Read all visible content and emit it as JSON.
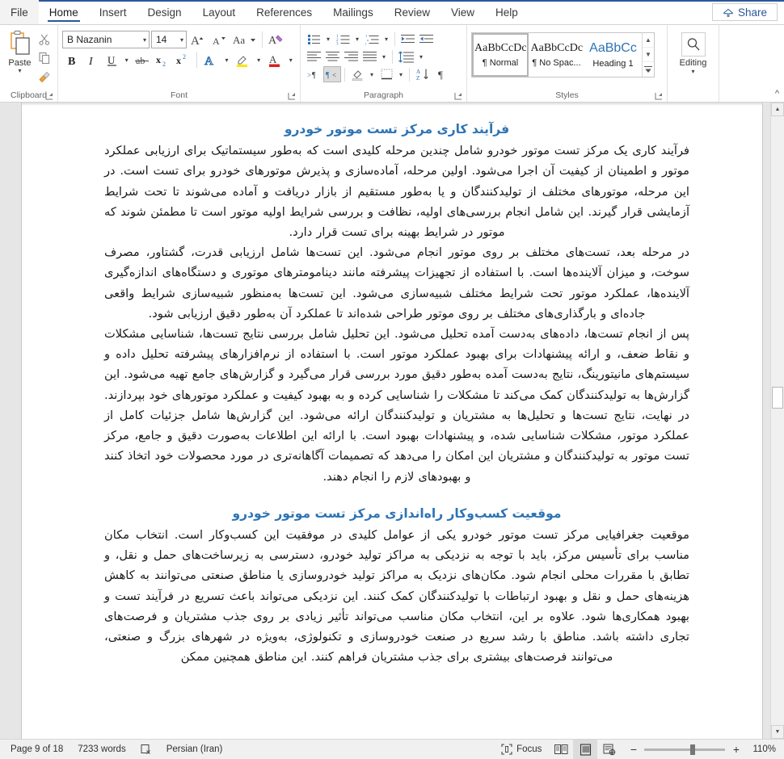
{
  "app": {
    "name": "Microsoft Word",
    "accent_color": "#2b579a",
    "heading_color": "#2e74b5"
  },
  "tabs": [
    {
      "label": "File",
      "name": "tab-file",
      "active": false
    },
    {
      "label": "Home",
      "name": "tab-home",
      "active": true
    },
    {
      "label": "Insert",
      "name": "tab-insert",
      "active": false
    },
    {
      "label": "Design",
      "name": "tab-design",
      "active": false
    },
    {
      "label": "Layout",
      "name": "tab-layout",
      "active": false
    },
    {
      "label": "References",
      "name": "tab-references",
      "active": false
    },
    {
      "label": "Mailings",
      "name": "tab-mailings",
      "active": false
    },
    {
      "label": "Review",
      "name": "tab-review",
      "active": false
    },
    {
      "label": "View",
      "name": "tab-view",
      "active": false
    },
    {
      "label": "Help",
      "name": "tab-help",
      "active": false
    }
  ],
  "share": {
    "label": "Share",
    "icon": "share-icon"
  },
  "ribbon": {
    "clipboard": {
      "group_label": "Clipboard",
      "paste_label": "Paste",
      "icons": [
        "paste-icon",
        "cut-scissors-icon",
        "copy-icon",
        "format-painter-icon"
      ]
    },
    "font": {
      "group_label": "Font",
      "font_name": "B Nazanin",
      "font_size": "14",
      "icons": [
        "grow-font-icon",
        "shrink-font-icon",
        "change-case-icon",
        "clear-formatting-icon",
        "bold-icon",
        "italic-icon",
        "underline-icon",
        "strikethrough-icon",
        "subscript-icon",
        "superscript-icon",
        "text-effects-icon",
        "text-highlight-color-icon",
        "font-color-icon"
      ]
    },
    "paragraph": {
      "group_label": "Paragraph",
      "icons": [
        "bullets-icon",
        "numbering-icon",
        "multilevel-list-icon",
        "increase-indent-icon",
        "decrease-indent-icon",
        "align-left-icon",
        "align-center-icon",
        "align-right-icon",
        "justify-icon",
        "line-spacing-icon",
        "ltr-text-direction-icon",
        "rtl-text-direction-icon",
        "shading-icon",
        "borders-icon",
        "sort-icon",
        "show-formatting-marks-icon"
      ],
      "active_icon": "rtl-text-direction-icon"
    },
    "styles": {
      "group_label": "Styles",
      "items": [
        {
          "preview": "AaBbCcDc",
          "name": "¶ Normal",
          "selected": true,
          "kind": "normal"
        },
        {
          "preview": "AaBbCcDc",
          "name": "¶ No Spac...",
          "selected": false,
          "kind": "normal"
        },
        {
          "preview": "AaBbCс",
          "name": "Heading 1",
          "selected": false,
          "kind": "heading"
        }
      ],
      "scroll_up": "▲",
      "scroll_down": "▼",
      "more": "☰"
    },
    "editing": {
      "group_label": "",
      "label": "Editing",
      "icon": "search-magnifier-icon",
      "caret": "˅"
    },
    "collapse_icon": "collapse-ribbon-chevron-icon"
  },
  "document": {
    "blocks": [
      {
        "type": "heading",
        "name": "document-heading-1",
        "text": "فرآیند کاری مرکز تست موتور خودرو"
      },
      {
        "type": "paragraph",
        "name": "document-paragraph-1",
        "text": "فرآیند کاری یک مرکز تست موتور خودرو شامل چندین مرحله کلیدی است که به‌طور سیستماتیک برای ارزیابی عملکرد موتور و اطمینان از کیفیت آن اجرا می‌شود. اولین مرحله، آماده‌سازی و پذیرش موتورهای خودرو برای تست است. در این مرحله، موتورهای مختلف از تولیدکنندگان و یا به‌طور مستقیم از بازار دریافت و آماده می‌شوند تا تحت شرایط آزمایشی قرار گیرند. این شامل انجام بررسی‌های اولیه، نظافت و بررسی شرایط اولیه موتور است تا مطمئن شوند که موتور در شرایط بهینه برای تست قرار دارد."
      },
      {
        "type": "paragraph",
        "name": "document-paragraph-2",
        "text": "در مرحله بعد، تست‌های مختلف بر روی موتور انجام می‌شود. این تست‌ها شامل ارزیابی قدرت، گشتاور، مصرف سوخت، و میزان آلاینده‌ها است. با استفاده از تجهیزات پیشرفته مانند دینامومترهای موتوری و دستگاه‌های اندازه‌گیری آلاینده‌ها، عملکرد موتور تحت شرایط مختلف شبیه‌سازی می‌شود. این تست‌ها به‌منظور شبیه‌سازی شرایط واقعی جاده‌ای و بارگذاری‌های مختلف بر روی موتور طراحی شده‌اند تا عملکرد آن به‌طور دقیق ارزیابی شود."
      },
      {
        "type": "paragraph",
        "name": "document-paragraph-3",
        "text": "پس از انجام تست‌ها، داده‌های به‌دست آمده تحلیل می‌شود. این تحلیل شامل بررسی نتایج تست‌ها، شناسایی مشکلات و نقاط ضعف، و ارائه پیشنهادات برای بهبود عملکرد موتور است. با استفاده از نرم‌افزارهای پیشرفته تحلیل داده و سیستم‌های مانیتورینگ، نتایج به‌دست آمده به‌طور دقیق مورد بررسی قرار می‌گیرد و گزارش‌های جامع تهیه می‌شود. این گزارش‌ها به تولیدکنندگان کمک می‌کند تا مشکلات را شناسایی کرده و به بهبود کیفیت و عملکرد موتورهای خود بپردازند."
      },
      {
        "type": "paragraph",
        "name": "document-paragraph-4",
        "text": "در نهایت، نتایج تست‌ها و تحلیل‌ها به مشتریان و تولیدکنندگان ارائه می‌شود. این گزارش‌ها شامل جزئیات کامل از عملکرد موتور، مشکلات شناسایی شده، و پیشنهادات بهبود است. با ارائه این اطلاعات به‌صورت دقیق و جامع، مرکز تست موتور به تولیدکنندگان و مشتریان این امکان را می‌دهد که تصمیمات آگاهانه‌تری در مورد محصولات خود اتخاذ کنند و بهبودهای لازم را انجام دهند."
      },
      {
        "type": "heading",
        "name": "document-heading-2",
        "text": "موقعیت کسب‌وکار راه‌اندازی مرکز تست موتور خودرو"
      },
      {
        "type": "paragraph",
        "name": "document-paragraph-5",
        "text": "موقعیت جغرافیایی مرکز تست موتور خودرو یکی از عوامل کلیدی در موفقیت این کسب‌وکار است. انتخاب مکان مناسب برای تأسیس مرکز، باید با توجه به نزدیکی به مراکز تولید خودرو، دسترسی به زیرساخت‌های حمل و نقل، و تطابق با مقررات محلی انجام شود. مکان‌های نزدیک به مراکز تولید خودروسازی یا مناطق صنعتی می‌توانند به کاهش هزینه‌های حمل و نقل و بهبود ارتباطات با تولیدکنندگان کمک کنند. این نزدیکی می‌تواند باعث تسریع در فرآیند تست و بهبود همکاری‌ها شود. علاوه بر این، انتخاب مکان مناسب می‌تواند تأثیر زیادی بر روی جذب مشتریان و فرصت‌های تجاری داشته باشد. مناطق با رشد سریع در صنعت خودروسازی و تکنولوژی، به‌ویژه در شهرهای بزرگ و صنعتی، می‌توانند فرصت‌های بیشتری برای جذب مشتریان فراهم کنند. این مناطق همچنین ممکن"
      }
    ]
  },
  "statusbar": {
    "page_info": "Page 9 of 18",
    "word_count": "7233 words",
    "proofing_icon": "proofing-errors-icon",
    "language": "Persian (Iran)",
    "focus_label": "Focus",
    "focus_icon": "focus-mode-icon",
    "views": [
      {
        "name": "read-mode-view-button",
        "icon": "read-mode-icon",
        "active": false
      },
      {
        "name": "print-layout-view-button",
        "icon": "print-layout-icon",
        "active": true
      },
      {
        "name": "web-layout-view-button",
        "icon": "web-layout-icon",
        "active": false
      }
    ],
    "zoom_out": "−",
    "zoom_in": "+",
    "zoom_level": "110%"
  }
}
